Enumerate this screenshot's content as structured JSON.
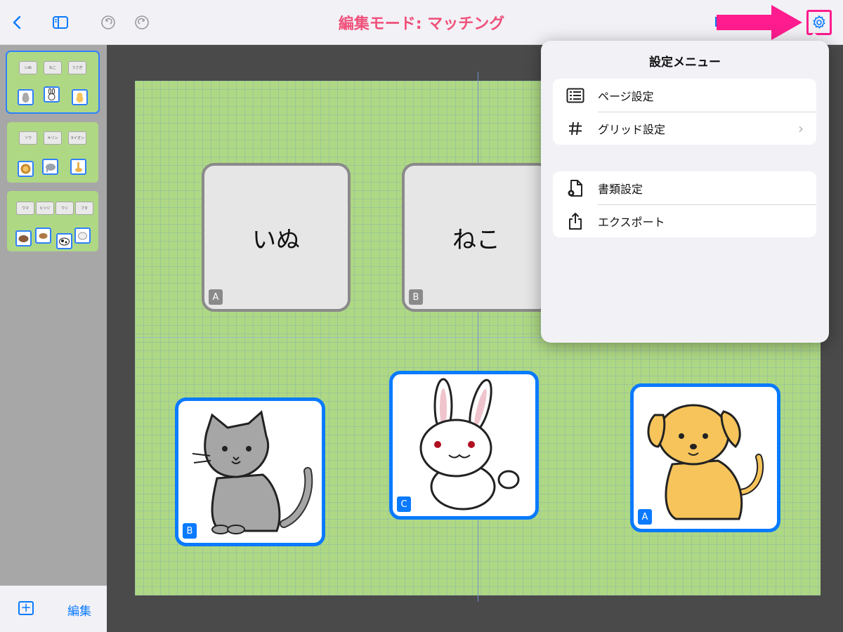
{
  "header": {
    "title": "編集モード: マッチング",
    "back_icon": "chevron-left-icon",
    "sidebar_icon": "sidebar-toggle-icon",
    "undo_icon": "undo-icon",
    "redo_icon": "redo-icon",
    "settings_icon": "gear-icon"
  },
  "sidebar": {
    "pages": [
      {
        "words": [
          "いぬ",
          "ねこ",
          "うさぎ"
        ],
        "selected": true
      },
      {
        "words": [
          "ゾウ",
          "キリン",
          "ライオン"
        ],
        "selected": false
      },
      {
        "words": [
          "ウマ",
          "ヒツジ",
          "ウシ",
          "ブタ"
        ],
        "selected": false
      }
    ],
    "footer": {
      "add_icon": "plus-square-icon",
      "edit_label": "編集"
    }
  },
  "canvas": {
    "word_cards": [
      {
        "text": "いぬ",
        "badge": "A"
      },
      {
        "text": "ねこ",
        "badge": "B"
      }
    ],
    "picture_cards": [
      {
        "animal": "cat",
        "badge": "B"
      },
      {
        "animal": "rabbit",
        "badge": "C"
      },
      {
        "animal": "dog",
        "badge": "A"
      }
    ]
  },
  "menu": {
    "title": "設定メニュー",
    "group1": [
      {
        "label": "ページ設定",
        "icon": "page-list-icon"
      },
      {
        "label": "グリッド設定",
        "icon": "grid-hash-icon",
        "chevron": "›"
      }
    ],
    "group2": [
      {
        "label": "書類設定",
        "icon": "document-gear-icon"
      },
      {
        "label": "エクスポート",
        "icon": "share-icon"
      }
    ]
  },
  "colors": {
    "accent": "#0a7aff",
    "title": "#f0507a",
    "highlight_arrow": "#ff1c8e",
    "canvas": "#afd884"
  }
}
